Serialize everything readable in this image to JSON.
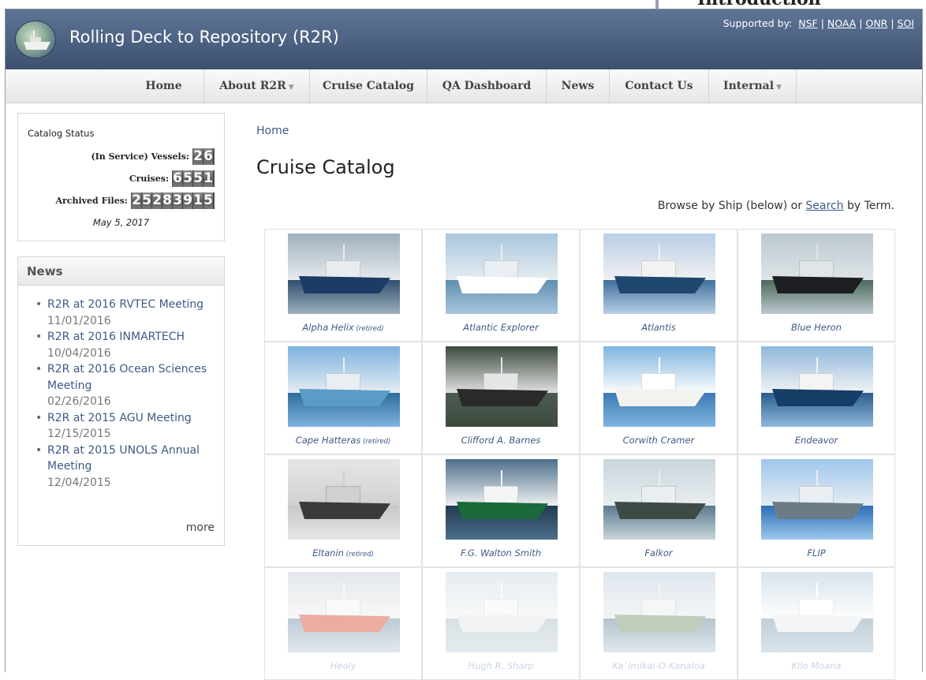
{
  "top_clip_text": "Introduction",
  "header": {
    "site_title": "Rolling Deck to Repository (R2R)",
    "supported_by": "Supported by:",
    "sponsors": [
      "NSF",
      "NOAA",
      "ONR",
      "SOI"
    ],
    "separator": " | "
  },
  "nav": {
    "items": [
      {
        "label": "Home"
      },
      {
        "label": "About R2R",
        "dropdown": true
      },
      {
        "label": "Cruise Catalog"
      },
      {
        "label": "QA Dashboard"
      },
      {
        "label": "News"
      },
      {
        "label": "Contact Us"
      },
      {
        "label": "Internal",
        "dropdown": true
      }
    ],
    "caret": "▼"
  },
  "catalog_status": {
    "title": "Catalog Status",
    "vessels_label": "(In Service) Vessels:",
    "vessels": "26",
    "cruises_label": "Cruises:",
    "cruises": "6551",
    "files_label": "Archived Files:",
    "files": "25283915",
    "date": "May 5, 2017"
  },
  "news": {
    "heading": "News",
    "items": [
      {
        "title": "R2R at 2016 RVTEC Meeting",
        "date": "11/01/2016"
      },
      {
        "title": "R2R at 2016 INMARTECH",
        "date": "10/04/2016"
      },
      {
        "title": "R2R at 2016 Ocean Sciences Meeting",
        "date": "02/26/2016"
      },
      {
        "title": "R2R at 2015 AGU Meeting",
        "date": "12/15/2015"
      },
      {
        "title": "R2R at 2015 UNOLS Annual Meeting",
        "date": "12/04/2015"
      }
    ],
    "more": "more"
  },
  "main": {
    "breadcrumb": "Home",
    "title": "Cruise Catalog",
    "browse_prefix": "Browse by Ship (below) or ",
    "browse_link": "Search",
    "browse_suffix": " by Term."
  },
  "ships": [
    {
      "name": "Alpha Helix",
      "note": "(retired)"
    },
    {
      "name": "Atlantic Explorer",
      "note": ""
    },
    {
      "name": "Atlantis",
      "note": ""
    },
    {
      "name": "Blue Heron",
      "note": ""
    },
    {
      "name": "Cape Hatteras",
      "note": "(retired)"
    },
    {
      "name": "Clifford A. Barnes",
      "note": ""
    },
    {
      "name": "Corwith Cramer",
      "note": ""
    },
    {
      "name": "Endeavor",
      "note": ""
    },
    {
      "name": "Eltanin",
      "note": "(retired)"
    },
    {
      "name": "F.G. Walton Smith",
      "note": ""
    },
    {
      "name": "Falkor",
      "note": ""
    },
    {
      "name": "FLIP",
      "note": ""
    },
    {
      "name": "Healy",
      "note": ""
    },
    {
      "name": "Hugh R. Sharp",
      "note": ""
    },
    {
      "name": "Ka`imikai-O-Kanaloa",
      "note": ""
    },
    {
      "name": "Kilo Moana",
      "note": ""
    }
  ],
  "colors": {
    "header_top": "#5e7596",
    "header_bottom": "#3d5170",
    "link": "#3e5a86"
  }
}
